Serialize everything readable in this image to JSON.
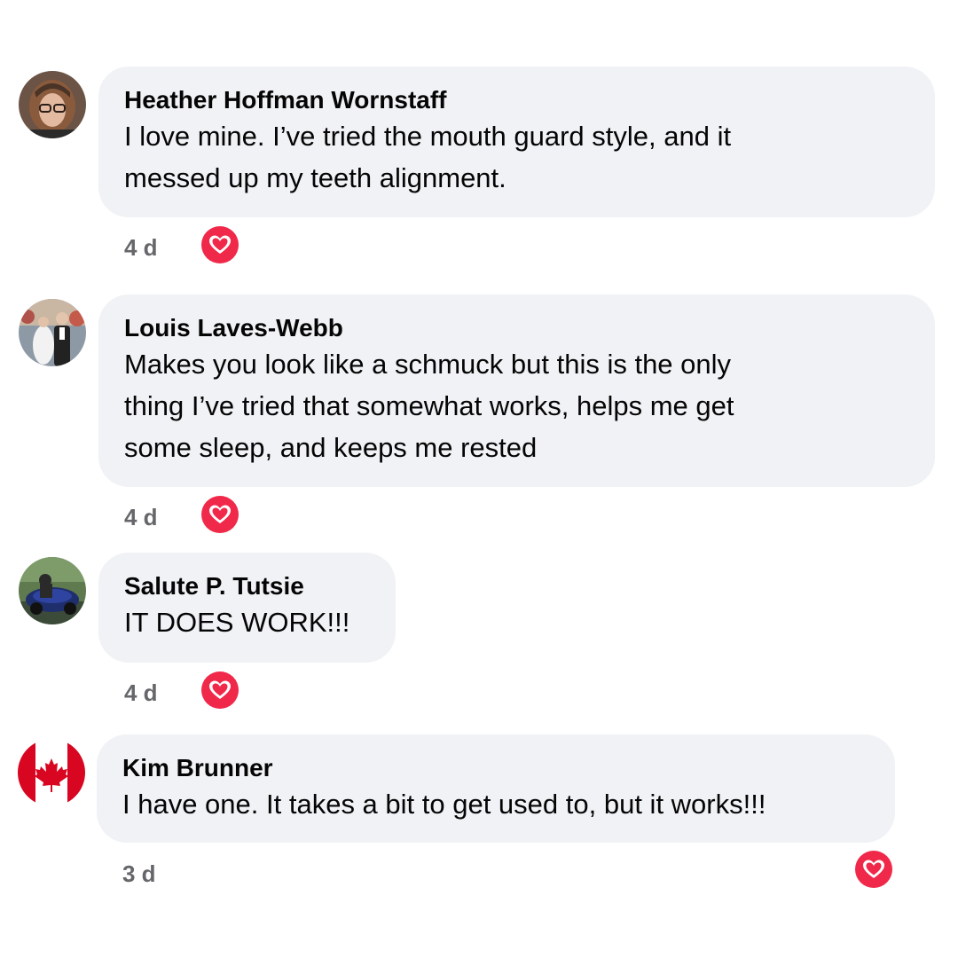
{
  "comments": [
    {
      "author": "Heather Hoffman Wornstaff",
      "text_lines": [
        "I love mine. I’ve tried the mouth guard style, and it",
        "messed up my teeth alignment."
      ],
      "time": "4 d",
      "reaction": "heart-icon"
    },
    {
      "author": "Louis Laves-Webb",
      "text_lines": [
        "Makes you look like a schmuck but this is the only",
        "thing I’ve tried that somewhat works, helps me get",
        "some sleep, and keeps me rested"
      ],
      "time": "4 d",
      "reaction": "heart-icon"
    },
    {
      "author": "Salute P. Tutsie",
      "text_lines": [
        "IT DOES WORK!!!"
      ],
      "time": "4 d",
      "reaction": "heart-icon"
    },
    {
      "author": "Kim Brunner",
      "text_lines": [
        "I have one. It takes a bit to get used to, but it works!!!"
      ],
      "time": "3 d",
      "reaction": "heart-icon"
    }
  ],
  "colors": {
    "bubble": "#f0f2f5",
    "meta_text": "#65676b",
    "reaction_red": "#f02849"
  }
}
